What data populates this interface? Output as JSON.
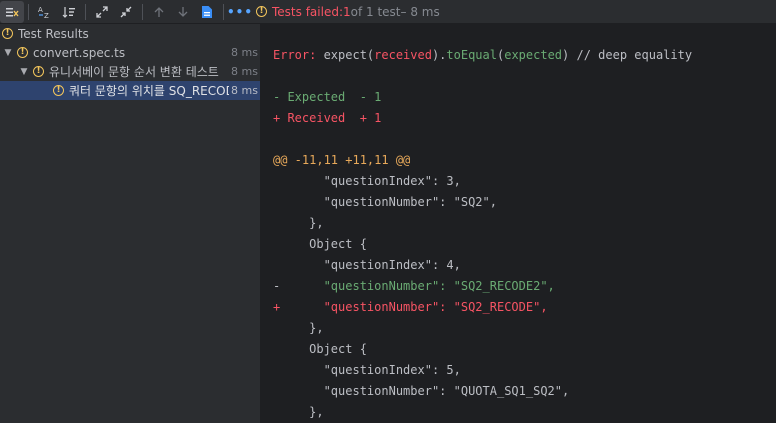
{
  "toolbar": {
    "status_failed": "Tests failed: ",
    "status_count": "1",
    "status_of": " of 1 test",
    "status_time": " – 8 ms"
  },
  "tree": [
    {
      "label": "Test Results",
      "time": "",
      "expanded": true,
      "level": 0
    },
    {
      "label": "convert.spec.ts",
      "time": "8 ms",
      "expanded": true,
      "level": 1
    },
    {
      "label": "유니서베이 문항 순서 변환 테스트",
      "time": "8 ms",
      "expanded": true,
      "level": 2
    },
    {
      "label": "쿼터 문항의 위치를 SQ_RECODE",
      "time": "8 ms",
      "expanded": false,
      "level": 3
    }
  ],
  "output": {
    "error_prefix": "Error: ",
    "error_expect": "expect(",
    "error_received": "received",
    "error_mid": ").",
    "error_toequal": "toEqual",
    "error_open": "(",
    "error_expected": "expected",
    "error_close": ")",
    "error_comment": " // deep equality",
    "expected_line": "- Expected  - 1",
    "received_line": "+ Received  + 1",
    "hunk": "@@ -11,11 +11,11 @@",
    "lines": [
      {
        "prefix": " ",
        "text": "      \"questionIndex\": 3,",
        "kind": "plain"
      },
      {
        "prefix": " ",
        "text": "      \"questionNumber\": \"SQ2\",",
        "kind": "plain"
      },
      {
        "prefix": " ",
        "text": "    },",
        "kind": "plain"
      },
      {
        "prefix": " ",
        "text": "    Object {",
        "kind": "plain"
      },
      {
        "prefix": " ",
        "text": "      \"questionIndex\": 4,",
        "kind": "plain"
      },
      {
        "prefix": "-",
        "text": "      \"questionNumber\": \"SQ2_RECODE2\",",
        "kind": "expected"
      },
      {
        "prefix": "+",
        "text": "      \"questionNumber\": \"SQ2_RECODE\",",
        "kind": "received"
      },
      {
        "prefix": " ",
        "text": "    },",
        "kind": "plain"
      },
      {
        "prefix": " ",
        "text": "    Object {",
        "kind": "plain"
      },
      {
        "prefix": " ",
        "text": "      \"questionIndex\": 5,",
        "kind": "plain"
      },
      {
        "prefix": " ",
        "text": "      \"questionNumber\": \"QUOTA_SQ1_SQ2\",",
        "kind": "plain"
      },
      {
        "prefix": " ",
        "text": "    },",
        "kind": "plain"
      }
    ]
  }
}
